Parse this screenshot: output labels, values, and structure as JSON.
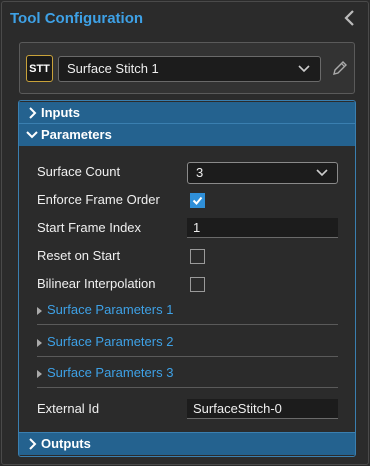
{
  "header": {
    "title": "Tool Configuration"
  },
  "tool": {
    "badge": "STT",
    "selected": "Surface Stitch 1"
  },
  "sections": {
    "inputs": "Inputs",
    "parameters": "Parameters",
    "outputs": "Outputs"
  },
  "parameters": {
    "surface_count": {
      "label": "Surface Count",
      "value": "3"
    },
    "enforce_frame_order": {
      "label": "Enforce Frame Order",
      "checked": true
    },
    "start_frame_index": {
      "label": "Start Frame Index",
      "value": "1"
    },
    "reset_on_start": {
      "label": "Reset on Start",
      "checked": false
    },
    "bilinear_interpolation": {
      "label": "Bilinear Interpolation",
      "checked": false
    },
    "surface_parameters": [
      "Surface Parameters 1",
      "Surface Parameters 2",
      "Surface Parameters 3"
    ],
    "external_id": {
      "label": "External Id",
      "value": "SurfaceStitch-0"
    }
  },
  "colors": {
    "accent": "#3ea1e6",
    "section_header": "#24628f",
    "checkbox_checked": "#2f8fd8",
    "badge_border": "#c9a23a",
    "background": "#2b2b2b"
  }
}
